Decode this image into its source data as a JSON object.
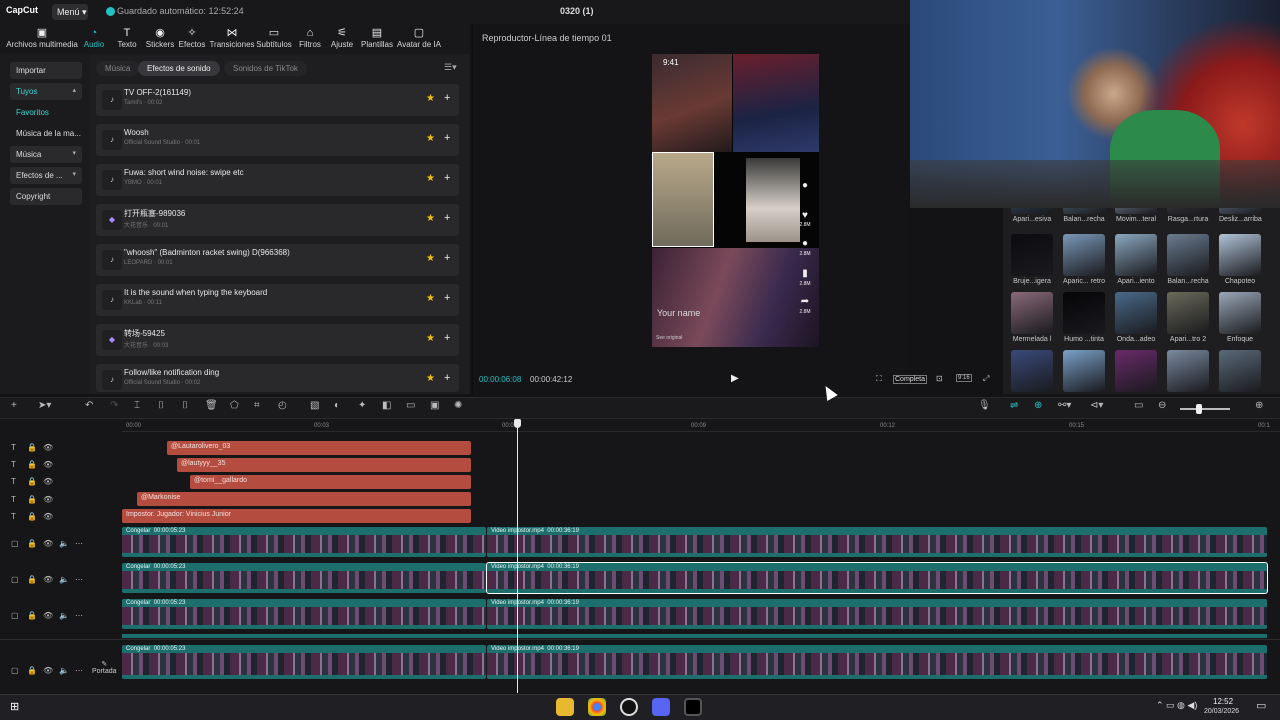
{
  "app": {
    "logo": "CapCut",
    "menu_label": "Menú",
    "save_status": "Guardado automático: 12:52:24",
    "project_title": "0320 (1)",
    "accent": "#22c1c3"
  },
  "toolbar": {
    "items": [
      {
        "label": "Archivos multimedia",
        "icon": "media-icon"
      },
      {
        "label": "Audio",
        "icon": "audio-icon",
        "active": true
      },
      {
        "label": "Texto",
        "icon": "text-icon"
      },
      {
        "label": "Stickers",
        "icon": "sticker-icon"
      },
      {
        "label": "Efectos",
        "icon": "effects-icon"
      },
      {
        "label": "Transiciones",
        "icon": "transitions-icon"
      },
      {
        "label": "Subtítulos",
        "icon": "subtitles-icon"
      },
      {
        "label": "Filtros",
        "icon": "filters-icon"
      },
      {
        "label": "Ajuste",
        "icon": "adjust-icon"
      },
      {
        "label": "Plantillas",
        "icon": "templates-icon"
      },
      {
        "label": "Avatar de IA",
        "icon": "ai-avatar-icon"
      }
    ]
  },
  "sidebar": {
    "items": [
      {
        "label": "Importar"
      },
      {
        "label": "Tuyos"
      },
      {
        "label": "Favoritos"
      },
      {
        "label": "Música de la ma..."
      },
      {
        "label": "Música"
      },
      {
        "label": "Efectos de ..."
      },
      {
        "label": "Copyright"
      }
    ]
  },
  "audio_tabs": [
    {
      "label": "Música"
    },
    {
      "label": "Efectos de sonido"
    },
    {
      "label": "Sonidos de TikTok"
    }
  ],
  "sounds": [
    {
      "title": "TV OFF-2(161149)",
      "subtitle": "Tamil's · 00:02"
    },
    {
      "title": "Woosh",
      "subtitle": "Official Sound Studio · 00:01"
    },
    {
      "title": "Fuwa: short wind noise: swipe etc",
      "subtitle": "YBMO · 00:01"
    },
    {
      "title": "打开瓶塞-989036",
      "subtitle": "大花音乐 · 00:01"
    },
    {
      "title": "\"whoosh\" (Badminton racket swing) D(966368)",
      "subtitle": "LEOPARD · 00:01"
    },
    {
      "title": "It is the sound when typing the keyboard",
      "subtitle": "KKLab · 00:11"
    },
    {
      "title": "转场-59425",
      "subtitle": "大花音乐 · 00:03"
    },
    {
      "title": "Follow/like notification ding",
      "subtitle": "Official Sound Studio · 00:02"
    }
  ],
  "player": {
    "title": "Reproductor-Línea de tiempo 01",
    "current_time": "00:00:06:08",
    "total_time": "00:00:42:12",
    "quality_label": "Completa",
    "ratio_label": "9:16",
    "preview": {
      "clock": "9:41",
      "username": "Your name",
      "see_original": "See original",
      "counts": [
        "2.8M",
        "2.8M",
        "2.8M",
        "2.8M"
      ]
    }
  },
  "effects": [
    {
      "label": "Apari...esiva"
    },
    {
      "label": "Balan...recha"
    },
    {
      "label": "Movim...teral"
    },
    {
      "label": "Rasga...rtura"
    },
    {
      "label": "Desliz...arriba"
    },
    {
      "label": "Bruje...igera"
    },
    {
      "label": "Aparic... retro"
    },
    {
      "label": "Apari...iento"
    },
    {
      "label": "Balan...recha"
    },
    {
      "label": "Chapoteo"
    },
    {
      "label": "Mermelada l"
    },
    {
      "label": "Humo ...tinta"
    },
    {
      "label": "Onda...adeo"
    },
    {
      "label": "Apari...tro 2"
    },
    {
      "label": "Enfoque"
    },
    {
      "label": ""
    },
    {
      "label": ""
    },
    {
      "label": ""
    },
    {
      "label": ""
    },
    {
      "label": ""
    }
  ],
  "ruler": [
    "00:00",
    "00:03",
    "00:06",
    "00:09",
    "00:12",
    "00:15",
    "00:1"
  ],
  "text_clips": [
    {
      "label": "@Lautarolivero_03"
    },
    {
      "label": "@lautyyy__35"
    },
    {
      "label": "@tomi__gallardo"
    },
    {
      "label": "@Markonise"
    },
    {
      "label": "Impostor. Jugador: Vinicius Junior"
    }
  ],
  "video_clips": {
    "freeze_label": "Congelar",
    "freeze_duration": "00:00:05:23",
    "main_label": "Video impostor.mp4",
    "main_duration": "00:00:36:19"
  },
  "cover_label": "Portada",
  "taskbar": {
    "time": "12:52",
    "date": "20/03/2026"
  }
}
